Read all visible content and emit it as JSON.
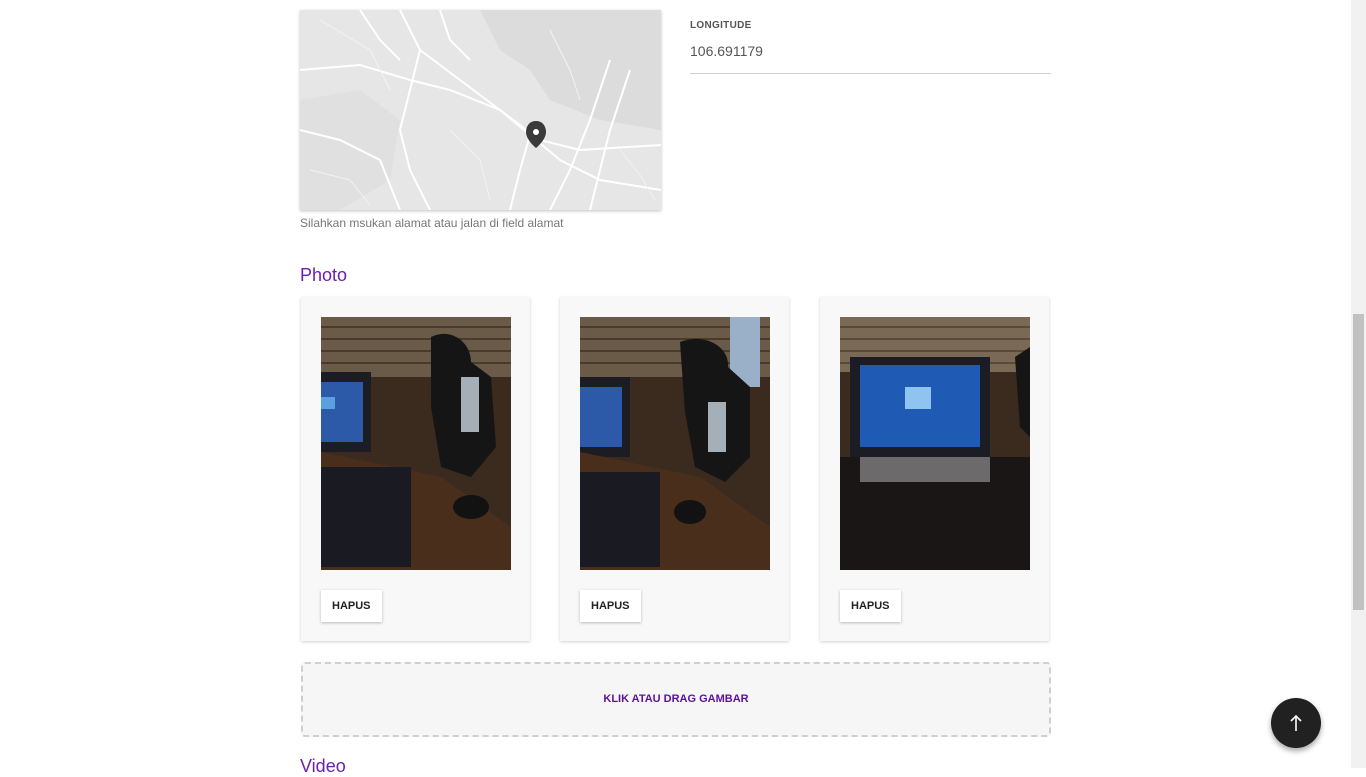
{
  "location": {
    "hint": "Silahkan msukan alamat atau jalan di field alamat",
    "longitude_label": "LONGITUDE",
    "longitude_value": "106.691179"
  },
  "photo_section": {
    "title": "Photo",
    "items": [
      {
        "delete_label": "HAPUS"
      },
      {
        "delete_label": "HAPUS"
      },
      {
        "delete_label": "HAPUS"
      }
    ],
    "dropzone_label": "KLIK ATAU DRAG GAMBAR"
  },
  "video_section": {
    "title": "Video"
  },
  "icons": {
    "map_marker": "map-marker-icon",
    "back_to_top": "arrow-up-icon"
  },
  "colors": {
    "accent": "#6a1fb0",
    "fab": "#212121"
  }
}
